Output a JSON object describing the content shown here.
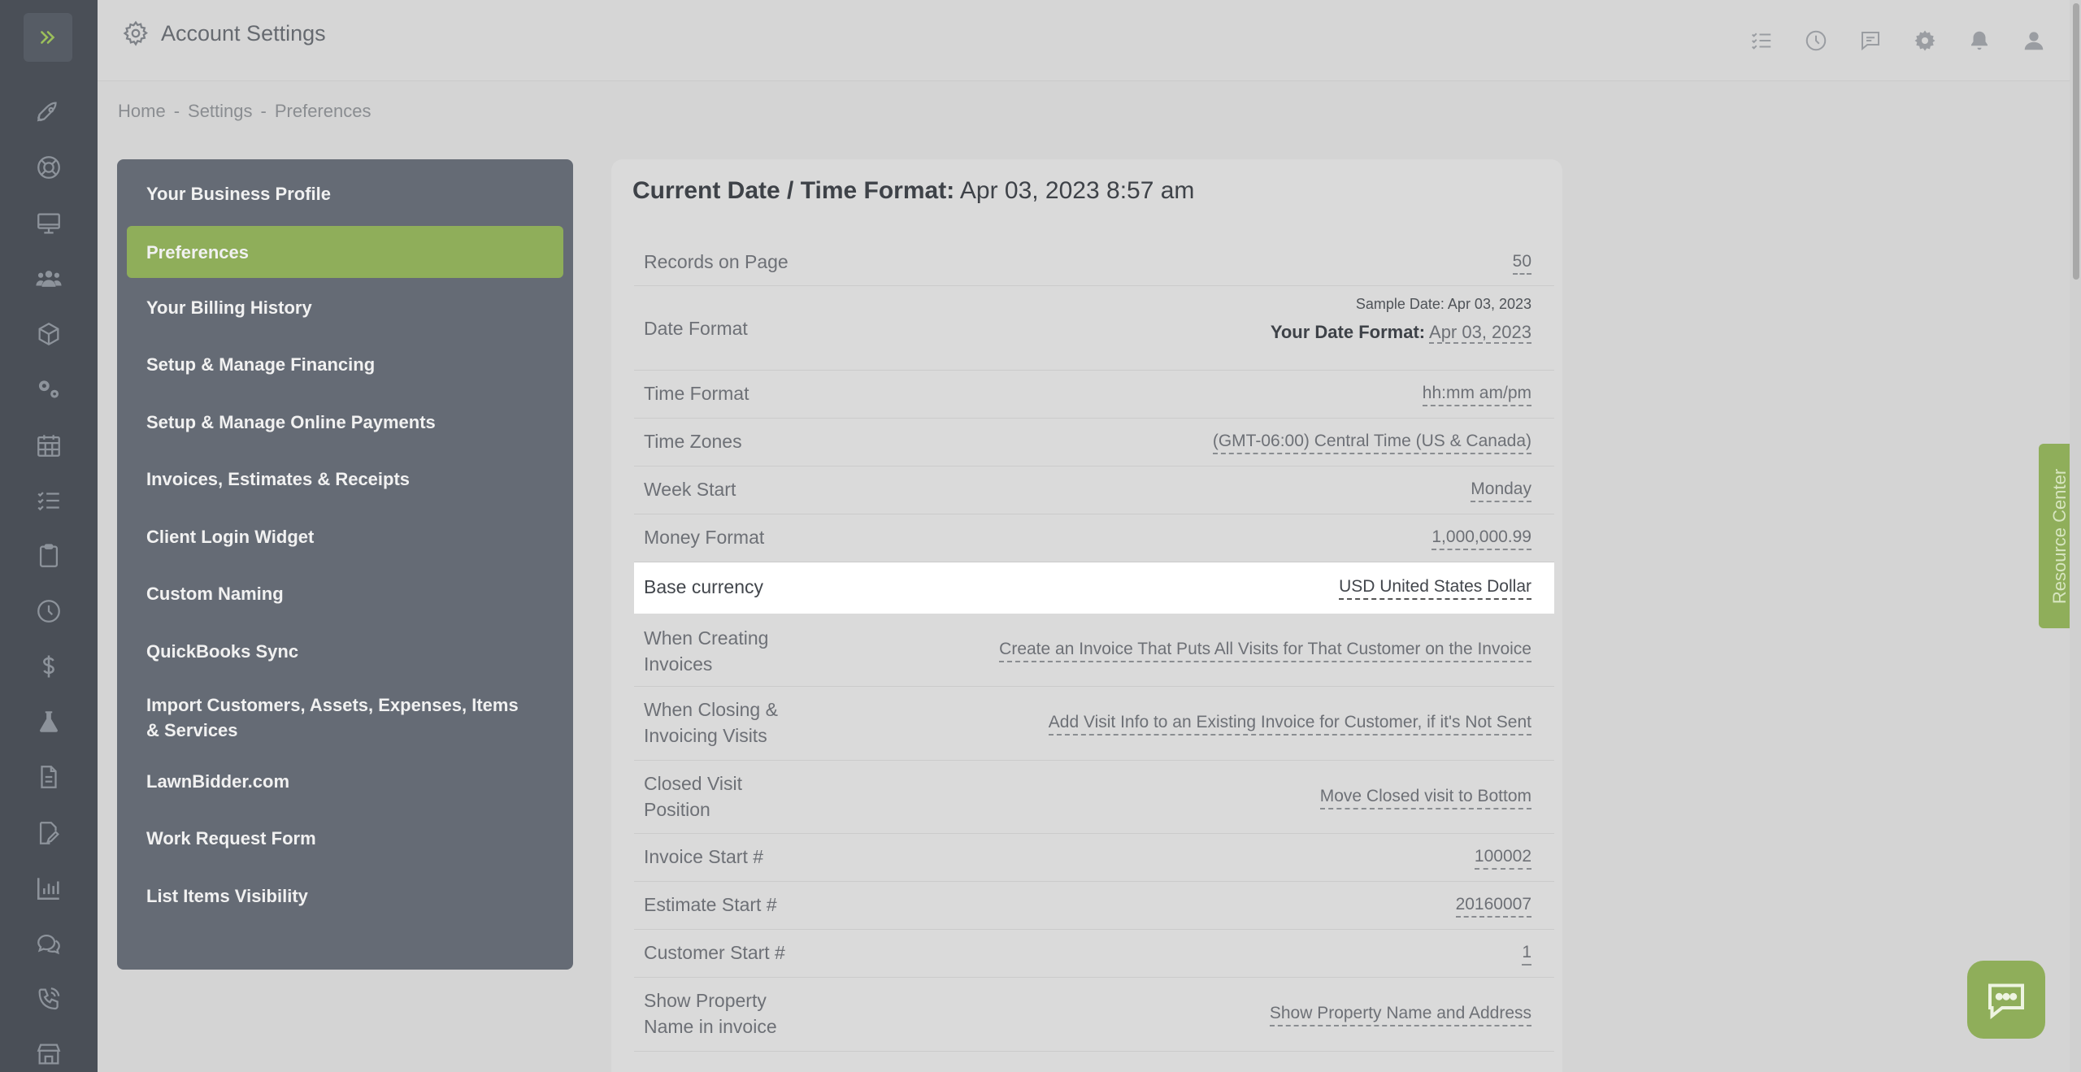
{
  "header": {
    "title": "Account Settings"
  },
  "breadcrumb": {
    "home": "Home",
    "sep1": "-",
    "settings": "Settings",
    "sep2": "-",
    "current": "Preferences"
  },
  "sidebar": {
    "items": [
      {
        "label": "Your Business Profile"
      },
      {
        "label": "Preferences"
      },
      {
        "label": "Your Billing History"
      },
      {
        "label": "Setup & Manage Financing"
      },
      {
        "label": "Setup & Manage Online Payments"
      },
      {
        "label": "Invoices, Estimates & Receipts"
      },
      {
        "label": "Client Login Widget"
      },
      {
        "label": "Custom Naming"
      },
      {
        "label": "QuickBooks Sync"
      },
      {
        "label": "Import Customers, Assets, Expenses, Items & Services"
      },
      {
        "label": "LawnBidder.com"
      },
      {
        "label": "Work Request Form"
      },
      {
        "label": "List Items Visibility"
      }
    ]
  },
  "panel": {
    "title_label": "Current Date / Time Format:",
    "title_value": "Apr 03, 2023 8:57 am",
    "rows": [
      {
        "label": "Records on Page",
        "value": "50"
      },
      {
        "label": "Date Format",
        "sample": "Sample Date: Apr 03, 2023",
        "your_label": "Your Date Format:",
        "value": "Apr 03, 2023"
      },
      {
        "label": "Time Format",
        "value": "hh:mm am/pm"
      },
      {
        "label": "Time Zones",
        "value": "(GMT-06:00) Central Time (US & Canada)"
      },
      {
        "label": "Week Start",
        "value": "Monday"
      },
      {
        "label": "Money Format",
        "value": "1,000,000.99"
      },
      {
        "label": "Base currency",
        "value": "USD United States Dollar"
      },
      {
        "label": "When Creating Invoices",
        "value": "Create an Invoice That Puts All Visits for That Customer on the Invoice"
      },
      {
        "label": "When Closing & Invoicing Visits",
        "value": "Add Visit Info to an Existing Invoice for Customer, if it's Not Sent"
      },
      {
        "label": "Closed Visit Position",
        "value": "Move Closed visit to Bottom"
      },
      {
        "label": "Invoice Start #",
        "value": "100002"
      },
      {
        "label": "Estimate Start #",
        "value": "20160007"
      },
      {
        "label": "Customer Start #",
        "value": "1"
      },
      {
        "label": "Show Property Name in invoice",
        "value": "Show Property Name and Address"
      }
    ]
  },
  "resource_center": {
    "label": "Resource Center"
  },
  "colors": {
    "accent": "#8fae5a",
    "sidebar": "#656b75",
    "rail": "#4a4f57"
  },
  "icons": [
    "chevrons-right-icon",
    "rocket-icon",
    "lifebuoy-icon",
    "monitor-icon",
    "users-icon",
    "cube-icon",
    "gears-icon",
    "calendar-icon",
    "checklist-icon",
    "clipboard-icon",
    "clock-icon",
    "dollar-icon",
    "flask-icon",
    "document-icon",
    "edit-document-icon",
    "bar-chart-icon",
    "chat-bubbles-icon",
    "phone-icon",
    "store-icon"
  ]
}
